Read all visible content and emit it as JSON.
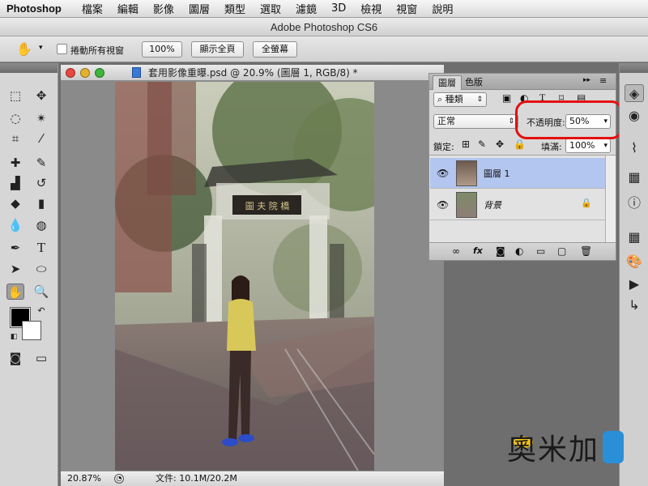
{
  "menu": {
    "app": "Photoshop",
    "items": [
      "檔案",
      "編輯",
      "影像",
      "圖層",
      "類型",
      "選取",
      "濾鏡",
      "3D",
      "檢視",
      "視窗",
      "說明"
    ]
  },
  "window_title": "Adobe Photoshop CS6",
  "options_bar": {
    "scroll_all_label": "捲動所有視窗",
    "zoom_100": "100%",
    "fit_screen": "顯示全頁",
    "full_screen": "全螢幕"
  },
  "document": {
    "title": "套用影像重曝.psd @ 20.9% (圖層 1, RGB/8) *",
    "zoom": "20.87%",
    "status": "文件: 10.1M/20.2M"
  },
  "layers_panel": {
    "tabs": [
      "圖層",
      "色版"
    ],
    "filter_label": "種類",
    "blend_mode": "正常",
    "opacity_label": "不透明度:",
    "opacity_value": "50%",
    "lock_label": "鎖定:",
    "fill_label": "填滿:",
    "fill_value": "100%",
    "layers": [
      {
        "name": "圖層 1",
        "selected": true
      },
      {
        "name": "背景",
        "selected": false,
        "locked": true
      }
    ]
  },
  "watermark": {
    "text": "奧米加"
  },
  "colors": {
    "highlight": "#e41010",
    "selected_layer": "#b3c6ef"
  },
  "icons": [
    "hand-icon",
    "move-icon",
    "marquee-icon",
    "lasso-icon",
    "magic-wand-icon",
    "crop-icon",
    "eyedropper-icon",
    "healing-brush-icon",
    "brush-icon",
    "clone-stamp-icon",
    "history-brush-icon",
    "eraser-icon",
    "gradient-icon",
    "blur-icon",
    "dodge-icon",
    "pen-icon",
    "type-icon",
    "path-selection-icon",
    "ellipse-icon",
    "zoom-icon",
    "eye-icon",
    "lock-icon",
    "link-icon",
    "fx-icon",
    "mask-icon",
    "adjustment-icon",
    "folder-icon",
    "new-layer-icon",
    "trash-icon"
  ]
}
